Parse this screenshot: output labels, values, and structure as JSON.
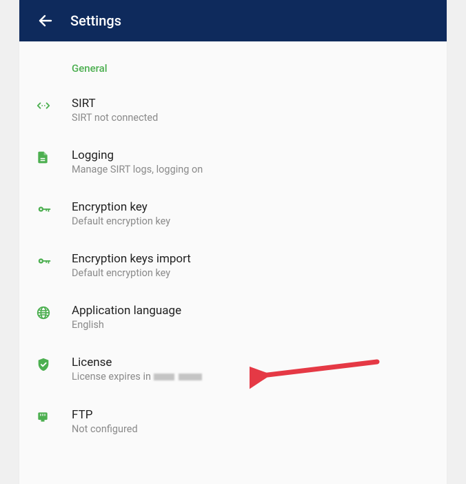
{
  "appBar": {
    "title": "Settings"
  },
  "sectionHeader": "General",
  "items": {
    "sirt": {
      "title": "SIRT",
      "subtitle": "SIRT not connected"
    },
    "logging": {
      "title": "Logging",
      "subtitle": "Manage SIRT logs, logging on"
    },
    "encKey": {
      "title": "Encryption key",
      "subtitle": "Default encryption key"
    },
    "encImport": {
      "title": "Encryption keys import",
      "subtitle": "Default encryption key"
    },
    "lang": {
      "title": "Application language",
      "subtitle": "English"
    },
    "license": {
      "title": "License",
      "subtitlePrefix": "License expires in "
    },
    "ftp": {
      "title": "FTP",
      "subtitle": "Not configured"
    }
  },
  "colors": {
    "accent": "#4caf50",
    "appBar": "#0e2a5c",
    "arrow": "#e53945"
  }
}
